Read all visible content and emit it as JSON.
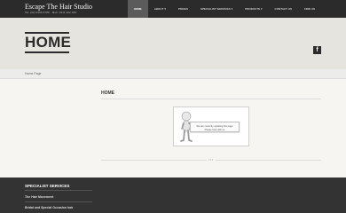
{
  "brand": {
    "title": "Escape The Hair Studio",
    "phone": "Tel: (02) 9450 6789 · Mob: 0411 222 333"
  },
  "nav": {
    "items": [
      {
        "label": "HOME",
        "active": true,
        "has_caret": false
      },
      {
        "label": "ABOUT",
        "active": false,
        "has_caret": true
      },
      {
        "label": "PRICES",
        "active": false,
        "has_caret": false
      },
      {
        "label": "SPECIALIST SERVICES",
        "active": false,
        "has_caret": true
      },
      {
        "label": "PRODUCTS",
        "active": false,
        "has_caret": true
      },
      {
        "label": "CONTACT US",
        "active": false,
        "has_caret": false
      },
      {
        "label": "FIND US",
        "active": false,
        "has_caret": false
      }
    ],
    "caret": "▾"
  },
  "hero": {
    "title": "HOME",
    "social": {
      "icon": "facebook-icon",
      "glyph": "f"
    }
  },
  "breadcrumb": {
    "text": "Home Page"
  },
  "content": {
    "title": "HOME",
    "notice_line1": "We are currently updating this page",
    "notice_line2": "Please bear with us",
    "separator": "•••"
  },
  "footer": {
    "title": "SPECIALIST SERVICES",
    "links": [
      "The Hair Movement",
      "Bridal and Special Occasion hair"
    ]
  },
  "colors": {
    "topbar": "#2b2b2b",
    "active_nav": "#5b5b5b",
    "hero_bg": "#e6e4df",
    "page_bg": "#f6f5f2",
    "footer_bg": "#333333"
  }
}
